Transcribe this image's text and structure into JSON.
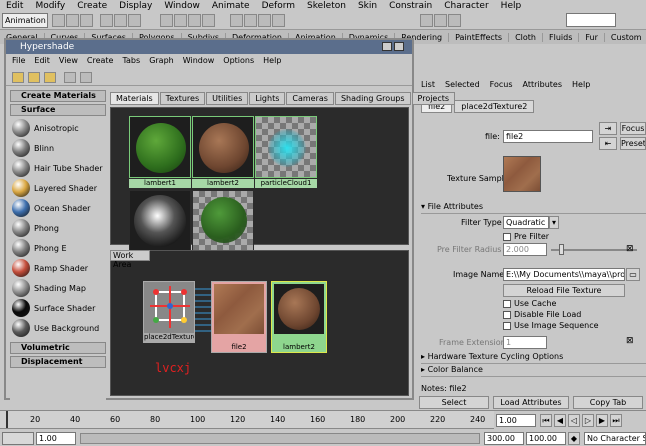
{
  "menubar": [
    "Edit",
    "Modify",
    "Create",
    "Display",
    "Window",
    "Animate",
    "Deform",
    "Skeleton",
    "Skin",
    "Constrain",
    "Character",
    "Help"
  ],
  "mode_selector": "Animation",
  "shelf_tabs": [
    "General",
    "Curves",
    "Surfaces",
    "Polygons",
    "Subdivs",
    "Deformation",
    "Animation",
    "Dynamics",
    "Rendering",
    "PaintEffects",
    "Cloth",
    "Fluids",
    "Fur",
    "Custom"
  ],
  "hypershade": {
    "title": "Hypershade",
    "menu": [
      "File",
      "Edit",
      "View",
      "Create",
      "Tabs",
      "Graph",
      "Window",
      "Options",
      "Help"
    ],
    "create_header": "Create Materials",
    "surface_header": "Surface",
    "materials": [
      {
        "name": "Anisotropic",
        "color": "#8a8a8a"
      },
      {
        "name": "Blinn",
        "color": "#7c7c7c"
      },
      {
        "name": "Hair Tube Shader",
        "color": "#888888"
      },
      {
        "name": "Layered Shader",
        "color": "#d9a640"
      },
      {
        "name": "Ocean Shader",
        "color": "#3d6fae"
      },
      {
        "name": "Phong",
        "color": "#858585"
      },
      {
        "name": "Phong E",
        "color": "#7f7f7f"
      },
      {
        "name": "Ramp Shader",
        "color": "#c44d3a"
      },
      {
        "name": "Shading Map",
        "color": "#909090"
      },
      {
        "name": "Surface Shader",
        "color": "#0a0a0a"
      },
      {
        "name": "Use Background",
        "color": "#5a5a5a"
      }
    ],
    "volumetric_header": "Volumetric",
    "displacement_header": "Displacement",
    "tabs": [
      "Materials",
      "Textures",
      "Utilities",
      "Lights",
      "Cameras",
      "Shading Groups",
      "Projects"
    ],
    "swatches": [
      "lambert1",
      "lambert2",
      "particleCloud1"
    ],
    "workarea_tab": "Work Area",
    "node_labels": [
      "place2dTexture",
      "file2",
      "lambert2"
    ],
    "red_text": "lvcxj"
  },
  "attr_editor": {
    "menu": [
      "List",
      "Selected",
      "Focus",
      "Attributes",
      "Help"
    ],
    "tabs": [
      "file2",
      "place2dTexture2"
    ],
    "node_field_label": "file:",
    "node_field_value": "file2",
    "focus_btn": "Focus",
    "presets_btn": "Presets",
    "texture_sample_label": "Texture Sample",
    "file_attr_header": "File Attributes",
    "filter_type_label": "Filter Type",
    "filter_type_value": "Quadratic",
    "pre_filter_label": "Pre Filter",
    "pre_filter_radius_label": "Pre Filter Radius",
    "pre_filter_radius_value": "2.000",
    "image_name_label": "Image Name",
    "image_name_value": "E:\\\\My Documents\\\\maya\\\\projects\\\\default\\\\sourceimages\\\\texture.jpg",
    "reload_btn": "Reload File Texture",
    "use_cache_label": "Use Cache",
    "disable_label": "Disable File Load",
    "use_frame_label": "Use Image Sequence",
    "frame_ext_label": "Frame Extension",
    "frame_ext_value": "1",
    "hw_header": "Hardware Texture Cycling Options",
    "color_balance_header": "Color Balance",
    "notes_label": "Notes: file2",
    "select_btn": "Select",
    "load_btn": "Load Attributes",
    "copy_btn": "Copy Tab"
  },
  "timeline": {
    "ticks": [
      "20",
      "40",
      "60",
      "80",
      "100",
      "120",
      "140",
      "160",
      "180",
      "200",
      "220",
      "240"
    ],
    "current_frame": "1.00",
    "start": "1.00",
    "end1": "300.00",
    "end2": "100.00",
    "character": "No Character Set"
  }
}
